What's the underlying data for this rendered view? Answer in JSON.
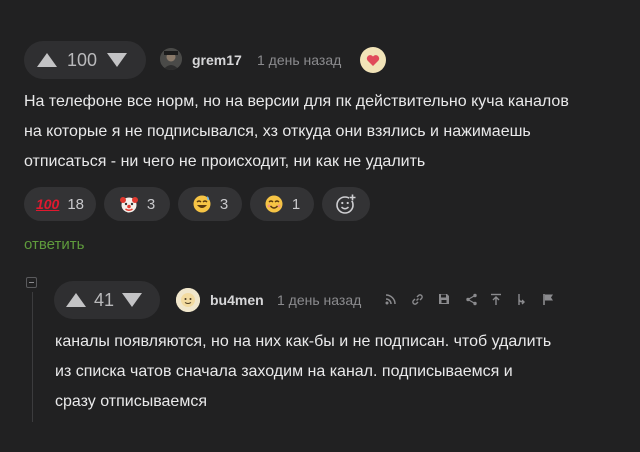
{
  "comment": {
    "rating": "100",
    "author": "grem17",
    "time": "1 день назад",
    "text": "На телефоне все норм, но на версии для пк действительно куча каналов\nна которые я не подписывался, хз откуда они взялись и нажимаешь\nотписаться - ни чего не происходит, ни как не удалить",
    "reactions": [
      {
        "icon": "hundred-points-emoji",
        "glyph": "100",
        "count": "18"
      },
      {
        "icon": "clown-face-emoji",
        "glyph": "🤡",
        "count": "3"
      },
      {
        "icon": "grinning-sweat-emoji",
        "glyph": "😅",
        "count": "3"
      },
      {
        "icon": "smiling-face-emoji",
        "glyph": "😊",
        "count": "1"
      }
    ],
    "reply_label": "ответить"
  },
  "reply": {
    "rating": "41",
    "author": "bu4men",
    "time": "1 день назад",
    "text": "каналы появляются, но на них как-бы и не подписан. чтоб удалить\nиз списка чатов сначала заходим на канал. подписываемся и\nсразу отписываемся"
  },
  "colors": {
    "background": "#212122",
    "vote_pill": "#2f2f31",
    "reply_link": "#5f9b3c",
    "hundred_red": "#e0192f"
  }
}
